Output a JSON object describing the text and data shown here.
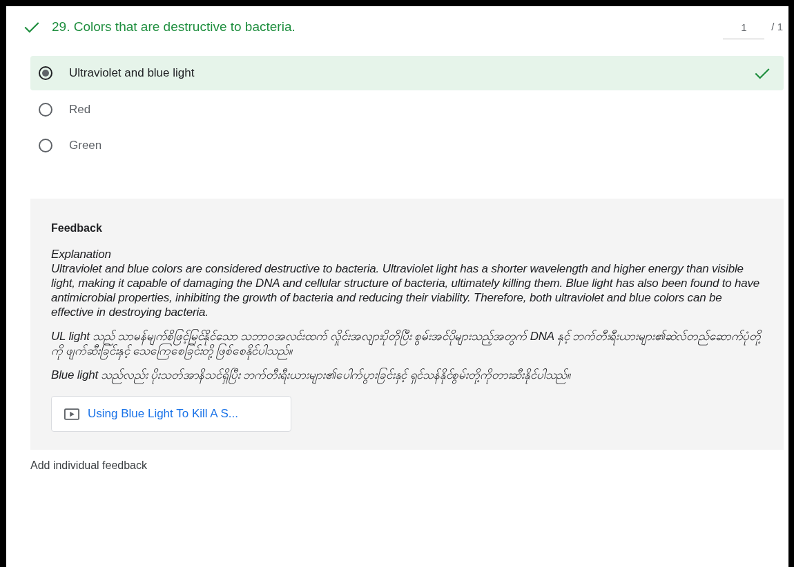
{
  "question": {
    "correct": true,
    "title": "29. Colors that are destructive to bacteria.",
    "score": "1",
    "max_score": "/ 1"
  },
  "options": [
    {
      "label": "Ultraviolet and blue light",
      "selected": true,
      "correct": true
    },
    {
      "label": "Red",
      "selected": false,
      "correct": false
    },
    {
      "label": "Green",
      "selected": false,
      "correct": false
    }
  ],
  "feedback": {
    "heading": "Feedback",
    "explanation_title": "Explanation",
    "paragraphs": [
      "Ultraviolet and blue colors are considered destructive to bacteria. Ultraviolet light has a shorter wavelength and higher energy than visible light, making it capable of damaging the DNA and cellular structure of bacteria, ultimately killing them. Blue light has also been found to have antimicrobial properties, inhibiting the growth of bacteria and reducing their viability. Therefore, both ultraviolet and blue colors can be effective in destroying bacteria.",
      "UL light သည် သာမန်မျက်စိဖြင့်မြင်နိုင်သော သဘာဝအလင်းထက် လှိုင်းအလျားပိုတိုပြီး စွမ်းအင်ပိုများသည့်အတွက် DNA နှင့် ဘက်တီးရီးယားများ၏ဆဲလ်တည်ဆောက်ပုံတို့ကို ဖျက်ဆီးခြင်းနှင့် သေကြေစေခြင်းတို့ဖြစ်စေနိုင်ပါသည်။",
      "Blue light သည်လည်း ပိုးသတ်အာနိသင်ရှိပြီး ဘက်တီးရီးယားများ၏ပေါက်ပွားခြင်းနှင့် ရှင်သန်နိုင်စွမ်းတို့ကိုတားဆီးနိုင်ပါသည်။"
    ],
    "link": {
      "label": "Using Blue Light To Kill A S..."
    }
  },
  "add_feedback": "Add individual feedback"
}
